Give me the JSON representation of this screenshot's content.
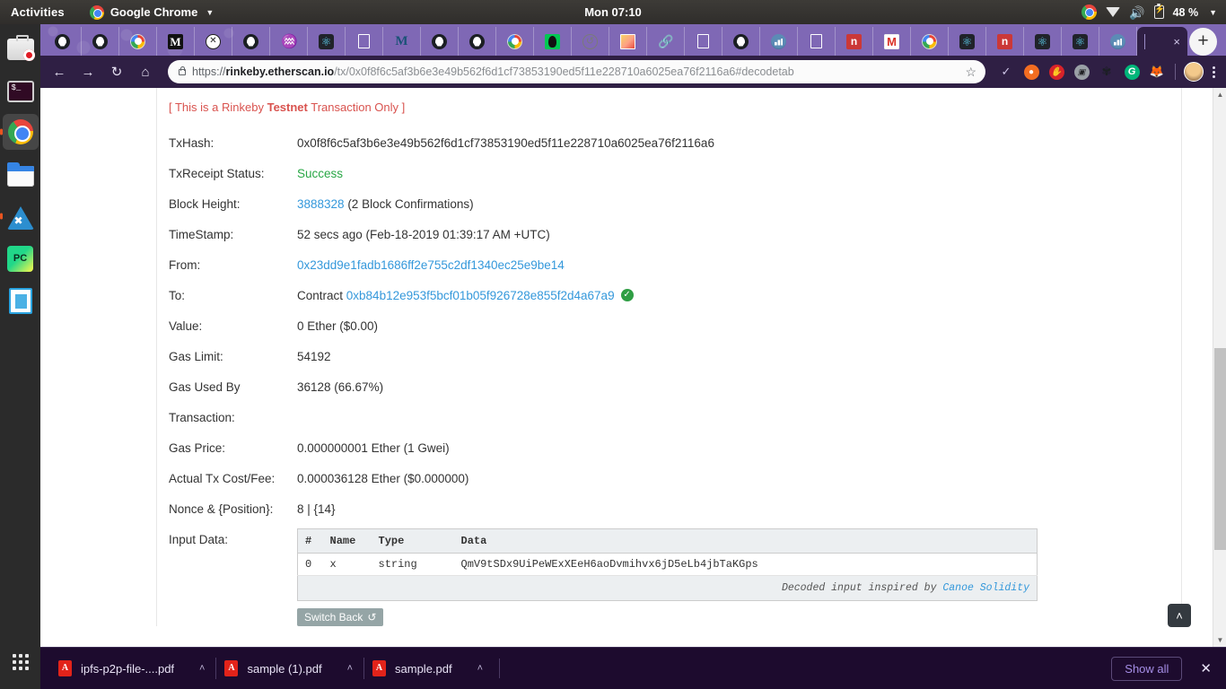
{
  "desktop": {
    "activities": "Activities",
    "app_menu": "Google Chrome",
    "clock": "Mon 07:10",
    "battery": "48 %",
    "dock": [
      {
        "name": "ubuntu-software",
        "label": "Ubuntu Software"
      },
      {
        "name": "terminal",
        "label": "Terminal"
      },
      {
        "name": "google-chrome",
        "label": "Google Chrome"
      },
      {
        "name": "files",
        "label": "Files"
      },
      {
        "name": "vscode",
        "label": "Visual Studio Code"
      },
      {
        "name": "pycharm",
        "label": "PyCharm"
      },
      {
        "name": "libreoffice",
        "label": "LibreOffice"
      },
      {
        "name": "show-applications",
        "label": "Show Applications"
      }
    ]
  },
  "browser": {
    "tabs": [
      {
        "icon": "github-icon"
      },
      {
        "icon": "github-icon"
      },
      {
        "icon": "google-icon"
      },
      {
        "icon": "medium-icon"
      },
      {
        "icon": "codesandbox-icon"
      },
      {
        "icon": "github-icon"
      },
      {
        "icon": "java-icon"
      },
      {
        "icon": "react-icon"
      },
      {
        "icon": "document-icon"
      },
      {
        "icon": "medium-blue-icon"
      },
      {
        "icon": "github-icon"
      },
      {
        "icon": "github-icon"
      },
      {
        "icon": "google-icon"
      },
      {
        "icon": "ethereum-green-icon"
      },
      {
        "icon": "history-icon"
      },
      {
        "icon": "image-icon"
      },
      {
        "icon": "link-icon"
      },
      {
        "icon": "document-icon"
      },
      {
        "icon": "github-icon"
      },
      {
        "icon": "analytics-icon"
      },
      {
        "icon": "document-icon"
      },
      {
        "icon": "npm-icon"
      },
      {
        "icon": "gmail-icon"
      },
      {
        "icon": "google-icon"
      },
      {
        "icon": "react-icon"
      },
      {
        "icon": "npm-icon"
      },
      {
        "icon": "react-icon"
      },
      {
        "icon": "react-icon"
      },
      {
        "icon": "analytics-icon"
      }
    ],
    "active_tab": {
      "icon": "etherscan-icon",
      "close": "×"
    },
    "new_tab_label": "+",
    "window_controls": {
      "minimize": "–",
      "maximize": "□",
      "close": "✕"
    },
    "nav": {
      "back": "←",
      "forward": "→",
      "reload": "↻",
      "home": "⌂"
    },
    "omnibox": {
      "scheme": "https://",
      "domain": "rinkeby.etherscan.io",
      "path": "/tx/0x0f8f6c5af3b6e3e49b562f6d1cf73853190ed5f11e228710a6025ea76f2116a6#decodetab",
      "lock_icon": "lock-icon",
      "star_icon": "☆"
    },
    "extensions": [
      {
        "name": "checkmark-extension",
        "glyph": "✓"
      },
      {
        "name": "orange-extension",
        "glyph": "●"
      },
      {
        "name": "adblock-extension",
        "glyph": "✋"
      },
      {
        "name": "video-extension",
        "glyph": "▣"
      },
      {
        "name": "dark-extension",
        "glyph": "✿"
      },
      {
        "name": "grammarly-extension",
        "glyph": "G"
      },
      {
        "name": "metamask-extension",
        "glyph": "ᾘa"
      }
    ],
    "profile_icon": "avatar",
    "menu_icon": "kebab-menu-icon"
  },
  "etherscan": {
    "testnet_note_pre": "[ This is a Rinkeby ",
    "testnet_note_bold": "Testnet",
    "testnet_note_post": " Transaction Only ]",
    "rows": [
      {
        "label": "TxHash:",
        "value": "0x0f8f6c5af3b6e3e49b562f6d1cf73853190ed5f11e228710a6025ea76f2116a6"
      },
      {
        "label": "TxReceipt Status:",
        "value": "Success"
      },
      {
        "label": "Block Height:",
        "link": "3888328",
        "suffix": " (2 Block Confirmations)"
      },
      {
        "label": "TimeStamp:",
        "value": "52 secs ago (Feb-18-2019 01:39:17 AM +UTC)"
      },
      {
        "label": "From:",
        "link": "0x23dd9e1fadb1686ff2e755c2df1340ec25e9be14"
      },
      {
        "label": "To:",
        "prefix": "Contract ",
        "link": "0xb84b12e953f5bcf01b05f926728e855f2d4a67a9",
        "verified_icon": "verified-check-icon"
      },
      {
        "label": "Value:",
        "value": "0 Ether ($0.00)"
      },
      {
        "label": "Gas Limit:",
        "value": "54192"
      },
      {
        "label": "Gas Used By Transaction:",
        "value": "36128 (66.67%)"
      },
      {
        "label": "Gas Price:",
        "value": "0.000000001 Ether (1 Gwei)"
      },
      {
        "label": "Actual Tx Cost/Fee:",
        "value": "0.000036128 Ether ($0.000000)"
      },
      {
        "label": "Nonce & {Position}:",
        "value": "8 | {14}"
      }
    ],
    "input_data": {
      "label": "Input Data:",
      "columns": [
        "#",
        "Name",
        "Type",
        "Data"
      ],
      "rows": [
        {
          "index": "0",
          "name": "x",
          "type": "string",
          "data": "QmV9tSDx9UiPeWExXEeH6aoDvmihvx6jD5eLb4jbTaKGps"
        }
      ],
      "footer_text": "Decoded input inspired by ",
      "footer_link": "Canoe Solidity",
      "switch_back_label": "Switch Back",
      "switch_back_icon": "↺"
    },
    "scroll_top_icon": "˄"
  },
  "downloads": {
    "items": [
      {
        "name": "ipfs-p2p-file-....pdf",
        "icon": "pdf-icon",
        "menu": "˄"
      },
      {
        "name": "sample (1).pdf",
        "icon": "pdf-icon",
        "menu": "˄"
      },
      {
        "name": "sample.pdf",
        "icon": "pdf-icon",
        "menu": "˄"
      }
    ],
    "show_all_label": "Show all",
    "close_label": "✕"
  },
  "colors": {
    "accent_link": "#3498db",
    "success": "#28a745",
    "warning_red": "#d9534f",
    "chrome_theme": "#2f1f44"
  }
}
